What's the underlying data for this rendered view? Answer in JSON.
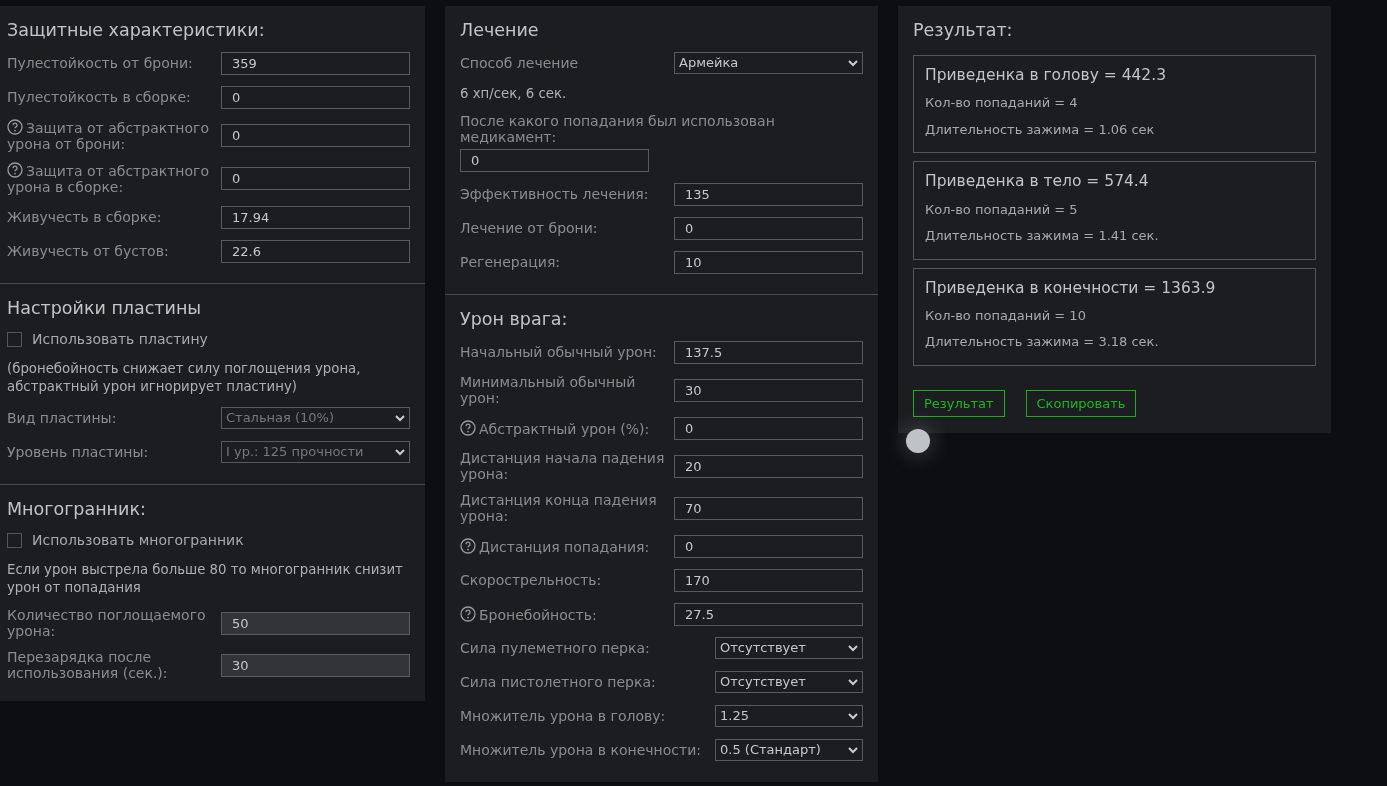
{
  "panels": [
    {
      "sections": [
        {
          "title": "Защитные характеристики:",
          "items": [
            {
              "kind": "input",
              "label": "Пулестойкость от брони:",
              "value": "359",
              "help": false,
              "disabled": false
            },
            {
              "kind": "input",
              "label": "Пулестойкость в сборке:",
              "value": "0",
              "help": false,
              "disabled": false
            },
            {
              "kind": "input",
              "label": "Защита от абстрактного урона от брони:",
              "value": "0",
              "help": true,
              "disabled": false
            },
            {
              "kind": "input",
              "label": "Защита от абстрактного урона в сборке:",
              "value": "0",
              "help": true,
              "disabled": false
            },
            {
              "kind": "input",
              "label": "Живучесть в сборке:",
              "value": "17.94",
              "help": false,
              "disabled": false
            },
            {
              "kind": "input",
              "label": "Живучесть от бустов:",
              "value": "22.6",
              "help": false,
              "disabled": false
            }
          ]
        },
        {
          "title": "Настройки пластины",
          "items": [
            {
              "kind": "checkbox",
              "label": "Использовать пластину",
              "checked": false
            },
            {
              "kind": "note",
              "text": "(бронебойность снижает силу поглощения урона, абстрактный урон игнорирует пластину)"
            },
            {
              "kind": "select",
              "label": "Вид пластины:",
              "value": "Стальная (10%)",
              "help": false,
              "disabled": true
            },
            {
              "kind": "select",
              "label": "Уровень пластины:",
              "value": "I ур.: 125 прочности",
              "help": false,
              "disabled": true
            }
          ]
        },
        {
          "title": "Многогранник:",
          "items": [
            {
              "kind": "checkbox",
              "label": "Использовать многогранник",
              "checked": false
            },
            {
              "kind": "note",
              "text": "Если урон выстрела больше 80 то многогранник снизит урон от попадания"
            },
            {
              "kind": "input",
              "label": "Количество поглощаемого урона:",
              "value": "50",
              "help": false,
              "disabled": true
            },
            {
              "kind": "input",
              "label": "Перезарядка после использования (сек.):",
              "value": "30",
              "help": false,
              "disabled": true
            }
          ]
        }
      ]
    },
    {
      "sections": [
        {
          "title": "Лечение",
          "items": [
            {
              "kind": "select",
              "label": "Способ лечение",
              "value": "Армейка",
              "help": false,
              "disabled": false
            },
            {
              "kind": "note",
              "text": "6 хп/сек, 6 сек."
            },
            {
              "kind": "stacked",
              "label": "После какого попадания был использован медикамент:",
              "value": "0",
              "help": false,
              "disabled": false
            },
            {
              "kind": "input",
              "label": "Эффективность лечения:",
              "value": "135",
              "help": false,
              "disabled": false
            },
            {
              "kind": "input",
              "label": "Лечение от брони:",
              "value": "0",
              "help": false,
              "disabled": false
            },
            {
              "kind": "input",
              "label": "Регенерация:",
              "value": "10",
              "help": false,
              "disabled": false
            }
          ]
        },
        {
          "title": "Урон врага:",
          "items": [
            {
              "kind": "input",
              "label": "Начальный обычный урон:",
              "value": "137.5",
              "help": false,
              "disabled": false
            },
            {
              "kind": "input",
              "label": "Минимальный обычный урон:",
              "value": "30",
              "help": false,
              "disabled": false
            },
            {
              "kind": "input",
              "label": "Абстрактный урон (%):",
              "value": "0",
              "help": true,
              "disabled": false
            },
            {
              "kind": "input",
              "label": "Дистанция начала падения урона:",
              "value": "20",
              "help": false,
              "disabled": false
            },
            {
              "kind": "input",
              "label": "Дистанция конца падения урона:",
              "value": "70",
              "help": false,
              "disabled": false
            },
            {
              "kind": "input",
              "label": "Дистанция попадания:",
              "value": "0",
              "help": true,
              "disabled": false
            },
            {
              "kind": "input",
              "label": "Скорострельность:",
              "value": "170",
              "help": false,
              "disabled": false
            },
            {
              "kind": "input",
              "label": "Бронебойность:",
              "value": "27.5",
              "help": true,
              "disabled": false
            },
            {
              "kind": "select",
              "label": "Сила пулеметного перка:",
              "value": "Отсутствует",
              "help": false,
              "disabled": false
            },
            {
              "kind": "select",
              "label": "Сила пистолетного перка:",
              "value": "Отсутствует",
              "help": false,
              "disabled": false
            },
            {
              "kind": "select",
              "label": "Множитель урона в голову:",
              "value": "1.25",
              "help": false,
              "disabled": false
            },
            {
              "kind": "select",
              "label": "Множитель урона в конечности:",
              "value": "0.5 (Стандарт)",
              "help": false,
              "disabled": false
            }
          ]
        }
      ]
    }
  ],
  "result": {
    "title": "Результат:",
    "cards": [
      {
        "title": "Приведенка в голову = 442.3",
        "lines": [
          "Кол-во попаданий = 4",
          "Длительность зажима = 1.06 сек"
        ]
      },
      {
        "title": "Приведенка в тело = 574.4",
        "lines": [
          "Кол-во попаданий = 5",
          "Длительность зажима = 1.41 сек."
        ]
      },
      {
        "title": "Приведенка в конечности = 1363.9",
        "lines": [
          "Кол-во попаданий = 10",
          "Длительность зажима = 3.18 сек."
        ]
      }
    ],
    "buttons": [
      "Результат",
      "Скопировать"
    ]
  }
}
